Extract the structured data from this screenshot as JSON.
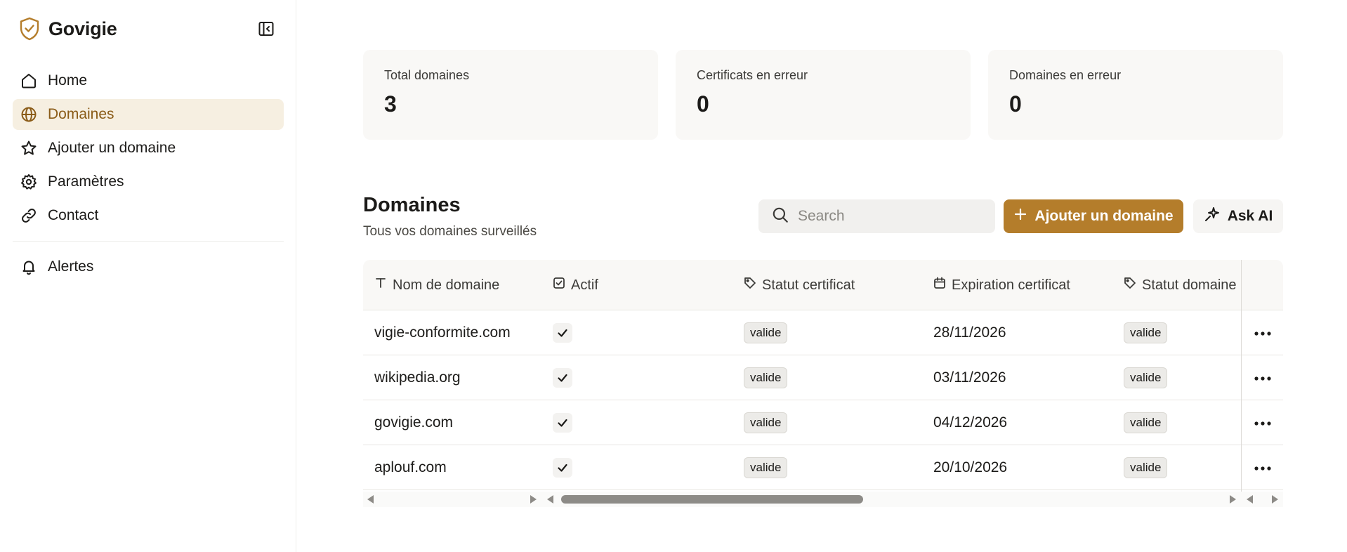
{
  "brand": {
    "name": "Govigie"
  },
  "colors": {
    "accent": "#b47d2b",
    "active_bg": "#f6efe1",
    "active_text": "#8a5b17"
  },
  "sidebar": {
    "items": [
      {
        "label": "Home",
        "icon": "home-icon",
        "active": false
      },
      {
        "label": "Domaines",
        "icon": "globe-icon",
        "active": true
      },
      {
        "label": "Ajouter un domaine",
        "icon": "star-icon",
        "active": false
      },
      {
        "label": "Paramètres",
        "icon": "gear-icon",
        "active": false
      },
      {
        "label": "Contact",
        "icon": "link-icon",
        "active": false
      }
    ],
    "secondary": [
      {
        "label": "Alertes",
        "icon": "bell-icon",
        "active": false
      }
    ]
  },
  "stats": [
    {
      "label": "Total domaines",
      "value": "3"
    },
    {
      "label": "Certificats en erreur",
      "value": "0"
    },
    {
      "label": "Domaines en erreur",
      "value": "0"
    }
  ],
  "section": {
    "title": "Domaines",
    "subtitle": "Tous vos domaines surveillés"
  },
  "search": {
    "placeholder": "Search"
  },
  "toolbar": {
    "add_label": "Ajouter un domaine",
    "ai_label": "Ask AI"
  },
  "table": {
    "columns": [
      {
        "label": "Nom de domaine",
        "icon": "text-type-icon"
      },
      {
        "label": "Actif",
        "icon": "checkbox-icon"
      },
      {
        "label": "Statut certificat",
        "icon": "tag-icon"
      },
      {
        "label": "Expiration certificat",
        "icon": "calendar-icon"
      },
      {
        "label": "Statut domaine",
        "icon": "tag-icon"
      }
    ],
    "rows": [
      {
        "domain": "vigie-conformite.com",
        "active": true,
        "cert_status": "valide",
        "expiration": "28/11/2026",
        "domain_status": "valide"
      },
      {
        "domain": "wikipedia.org",
        "active": true,
        "cert_status": "valide",
        "expiration": "03/11/2026",
        "domain_status": "valide"
      },
      {
        "domain": "govigie.com",
        "active": true,
        "cert_status": "valide",
        "expiration": "04/12/2026",
        "domain_status": "valide"
      },
      {
        "domain": "aplouf.com",
        "active": true,
        "cert_status": "valide",
        "expiration": "20/10/2026",
        "domain_status": "valide"
      }
    ]
  }
}
